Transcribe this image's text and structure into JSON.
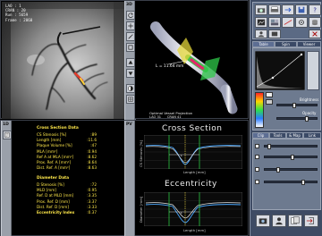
{
  "angio": {
    "mode": "2D",
    "overlay": [
      "LAO : 1",
      "CRAN : 20",
      "Run : 5659",
      "Frame : 2060"
    ]
  },
  "model3d": {
    "mode": "3D",
    "length_text": "L = 11.64 mm",
    "projection_title": "Optimal Vessel Projection",
    "projection_angles": "LAO 31      CRAN 41"
  },
  "results": {
    "mode": "1D",
    "cross_section_title": "Cross Section Data",
    "cross_section_rows": [
      {
        "label": "CS Stenosis [%]",
        "value": ":89"
      },
      {
        "label": "Length [mm]",
        "value": ":11.6"
      },
      {
        "label": "Plaque Volume [%]",
        "value": ":47"
      },
      {
        "label": "MLA [mm²]",
        "value": ":0.94"
      },
      {
        "label": "Ref A at MLA [mm²]",
        "value": ":8.62"
      },
      {
        "label": "Prox. Ref. A [mm²]",
        "value": ":8.64"
      },
      {
        "label": "Dist. Ref. A [mm²]",
        "value": ":8.63"
      }
    ],
    "diameter_title": "Diameter Data",
    "diameter_rows": [
      {
        "label": "D Stenosis [%]",
        "value": ":72"
      },
      {
        "label": "MLD [mm]",
        "value": ":0.95"
      },
      {
        "label": "Ref. D at MLD [mm]",
        "value": ":3.35"
      },
      {
        "label": "Prox. Ref. D [mm]",
        "value": ":3.37"
      },
      {
        "label": "Dist. Ref. D [mm]",
        "value": ":3.33"
      }
    ],
    "eccentricity_label": "Eccentricity Index",
    "eccentricity_value": ":0.37"
  },
  "plots": {
    "mode": "PV",
    "cross_section_title": "Cross Section",
    "eccentricity_title": "Eccentricity",
    "ylabel_top": "CS Stenosis [%]",
    "ylabel_bottom": "Diameter [mm]",
    "xlabel": "Length [mm]"
  },
  "right_panel": {
    "tabs_top": [
      "Table",
      "Spin",
      "Viewer"
    ],
    "brightness_label": "Brightness",
    "opacity_label": "Opacity",
    "tabs_bottom": [
      "Clip",
      "Tools",
      "& Map",
      "Link"
    ]
  },
  "colors": {
    "yellow_text": "#ffe84a",
    "green_marker": "#2fe04a",
    "curve_blue": "#4aa8ff",
    "curve_white": "#e6e6e6"
  }
}
